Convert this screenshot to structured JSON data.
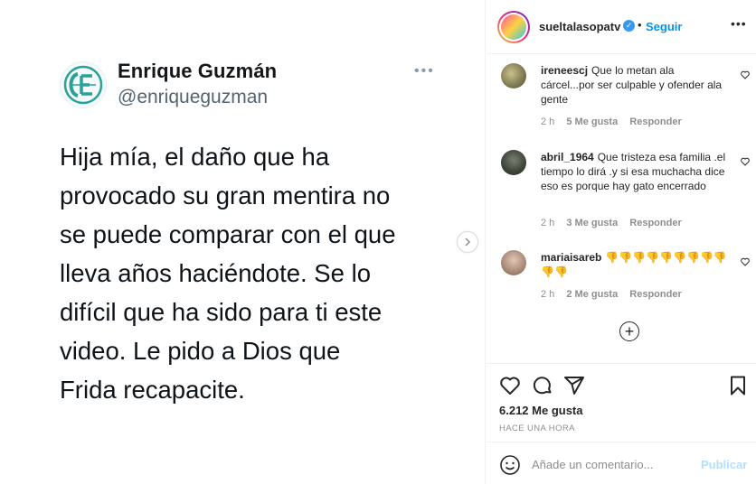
{
  "tweet": {
    "display_name": "Enrique Guzmán",
    "handle": "@enriqueguzman",
    "more_icon": "ellipsis-icon",
    "lines": [
      "Hija mía, el daño que ha",
      "provocado su gran mentira no",
      "se puede comparar con el que",
      "lleva años haciéndote. Se lo",
      "difícil que ha sido para ti este",
      "video. Le pido a Dios que",
      "Frida recapacite."
    ]
  },
  "post_header": {
    "username": "sueltalasopatv",
    "separator": "•",
    "follow_label": "Seguir",
    "more_label": "•••"
  },
  "comments": [
    {
      "username": "ireneescj",
      "text": "Que lo metan ala cárcel...por ser culpable y ofender ala gente",
      "time": "2 h",
      "likes": "5 Me gusta",
      "reply": "Responder"
    },
    {
      "username": "abril_1964",
      "text": "Que tristeza esa familia .el tiempo lo dirá .y si esa muchacha dice eso es porque hay gato encerrado",
      "time": "2 h",
      "likes": "3 Me gusta",
      "reply": "Responder"
    },
    {
      "username": "mariaisareb",
      "text": "👎👎👎👎👎👎👎👎👎👎👎",
      "time": "2 h",
      "likes": "2 Me gusta",
      "reply": "Responder"
    }
  ],
  "likes_count": "6.212 Me gusta",
  "posted_ago": "HACE UNA HORA",
  "comment_input": {
    "placeholder": "Añade un comentario...",
    "value": ""
  },
  "publish_label": "Publicar",
  "colors": {
    "accent": "#0095f6",
    "publish_disabled": "#b2dffc",
    "verified": "#3897f0",
    "muted": "#8e8e8e"
  }
}
